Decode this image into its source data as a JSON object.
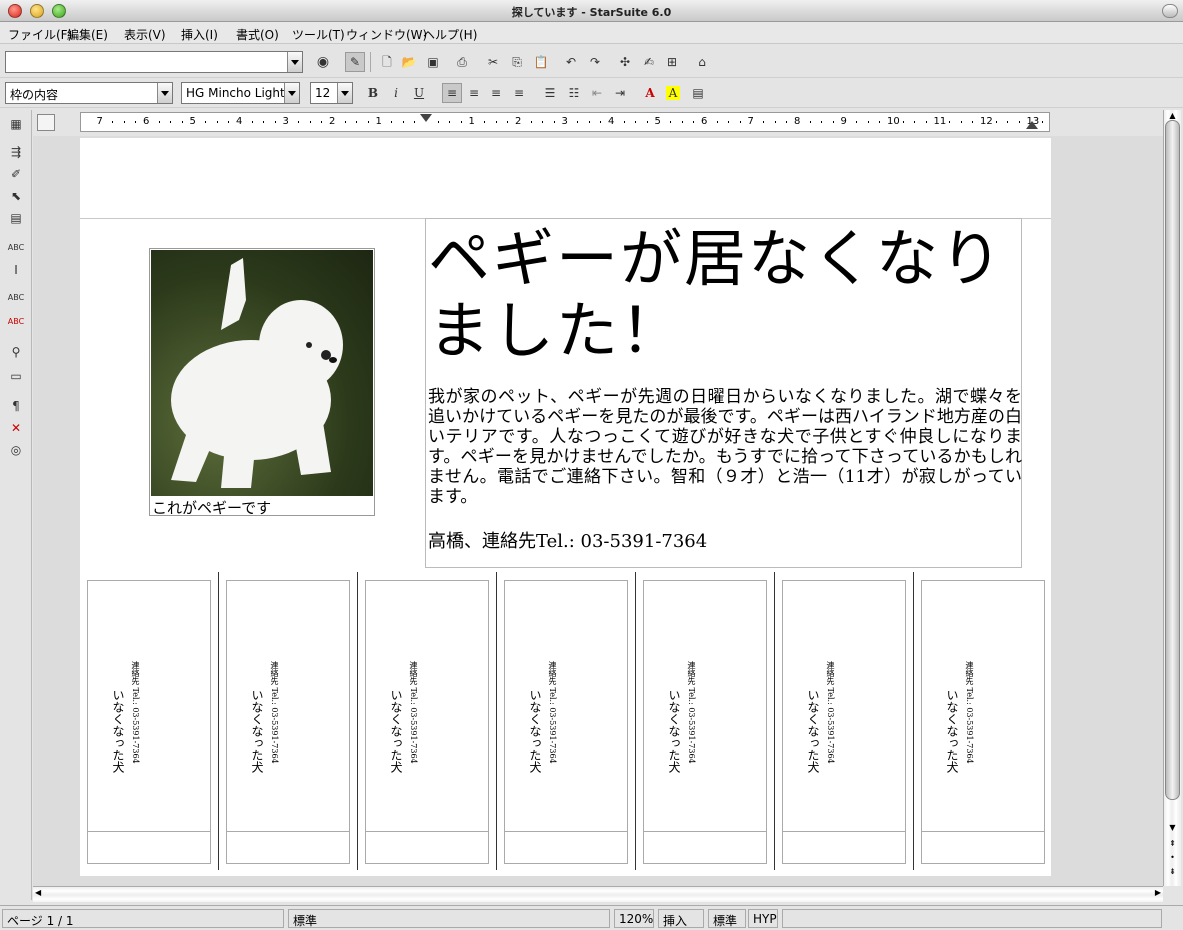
{
  "window": {
    "title": "探しています - StarSuite 6.0"
  },
  "menu": [
    "ファイル(F)",
    "編集(E)",
    "表示(V)",
    "挿入(I)",
    "書式(O)",
    "ツール(T)",
    "ウィンドウ(W)",
    "ヘルプ(H)"
  ],
  "formatting": {
    "style": "枠の内容",
    "font": "HG Mincho Light",
    "size": "12"
  },
  "ruler": {
    "labels": [
      "7",
      "6",
      "5",
      "4",
      "3",
      "2",
      "1",
      "1",
      "2",
      "3",
      "4",
      "5",
      "6",
      "7",
      "8",
      "9",
      "10",
      "11",
      "12",
      "13"
    ]
  },
  "document": {
    "headline": "ペギーが居なくなりました！",
    "caption": "これがペギーです",
    "body": "我が家のペット、ペギーが先週の日曜日からいなくなりました。湖で蝶々を追いかけているペギーを見たのが最後です。ペギーは西ハイランド地方産の白いテリアです。人なつっこくて遊びが好きな犬で子供とすぐ仲良しになります。ペギーを見かけませんでしたか。もうすでに拾って下さっているかもしれません。電話でご連絡下さい。智和（９才）と浩一（11才）が寂しがっています。",
    "contact": "高橋、連絡先Tel.: 03-5391-7364",
    "tear_off": {
      "line1": "いなくなった犬",
      "line2": "連絡先 Tel.: 03-5391-7364",
      "count": 7
    }
  },
  "status": {
    "page": "ページ 1 / 1",
    "style": "標準",
    "zoom": "120%",
    "insert": "挿入",
    "select": "標準",
    "hyp": "HYP"
  },
  "colors": {
    "font_color": "#cc0000",
    "highlight": "#ffff00"
  }
}
